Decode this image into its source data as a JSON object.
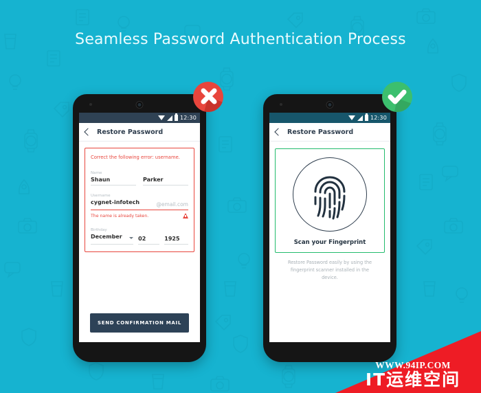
{
  "page": {
    "title": "Seamless Password Authentication Process",
    "background_color": "#16b3d0"
  },
  "badges": {
    "error": {
      "icon": "close-x-icon",
      "color": "#e8453c"
    },
    "success": {
      "icon": "check-icon",
      "color": "#3cbf6e"
    }
  },
  "phone_left": {
    "status_bar": {
      "time": "12:30",
      "wifi_icon": "wifi-icon",
      "signal_icon": "signal-icon",
      "battery_icon": "battery-icon"
    },
    "appbar": {
      "back_icon": "back-chevron-icon",
      "title": "Restore Password"
    },
    "error_summary": "Correct the following error: username.",
    "fields": {
      "name_label": "Name",
      "first_name": "Shaun",
      "last_name": "Parker",
      "username_label": "Username",
      "username": "cygnet-infotech",
      "username_suffix": "@email.com",
      "username_error": "The name is already taken.",
      "warning_icon": "warning-triangle-icon",
      "birthday_label": "Birthday",
      "birth_month": "December",
      "birth_day": "02",
      "birth_year": "1925",
      "month_caret_icon": "chevron-down-icon"
    },
    "cta_label": "SEND CONFIRMATION MAIL",
    "cta_color": "#2d4257",
    "error_color": "#e8453c"
  },
  "phone_right": {
    "status_bar": {
      "time": "12:30",
      "wifi_icon": "wifi-icon",
      "signal_icon": "signal-icon",
      "battery_icon": "battery-icon"
    },
    "appbar": {
      "back_icon": "back-chevron-icon",
      "title": "Restore Password"
    },
    "scanner": {
      "fingerprint_icon": "fingerprint-icon",
      "caption": "Scan your Fingerprint",
      "description": "Restore Password easily by using the fingerprint scanner installed in the device.",
      "border_color": "#22bb6c"
    }
  },
  "watermark": {
    "url": "WWW.94IP.COM",
    "name": "IT运维空间",
    "color": "#ee1c25"
  }
}
